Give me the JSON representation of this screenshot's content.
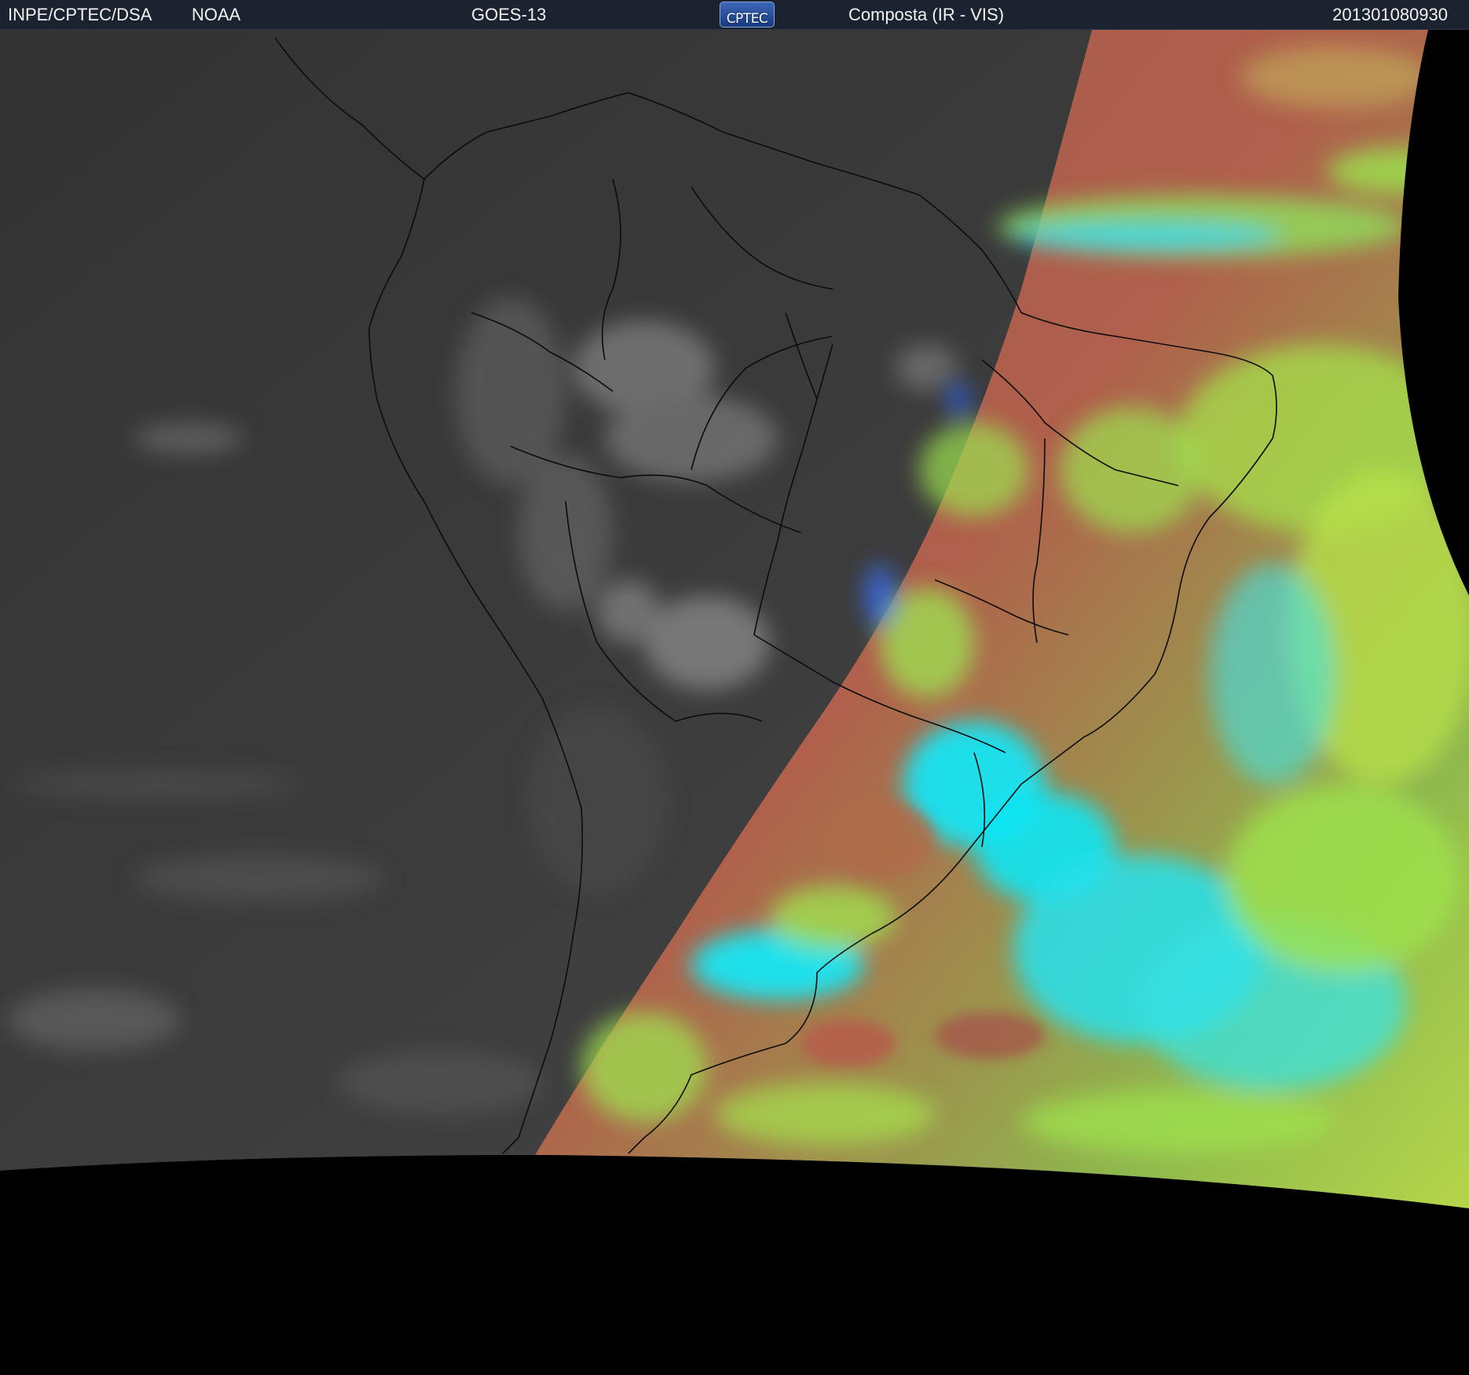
{
  "header": {
    "organization": "INPE/CPTEC/DSA",
    "agency": "NOAA",
    "satellite": "GOES-13",
    "logo_text": "CPTEC",
    "product": "Composta (IR - VIS)",
    "timestamp": "201301080930"
  },
  "colors": {
    "header_bg": "#1b2230",
    "night_gray": "#3a3a3a",
    "day_red": "#a7574a",
    "day_green": "#9fe34d",
    "day_cyan": "#12e8f2",
    "space": "#000000"
  }
}
